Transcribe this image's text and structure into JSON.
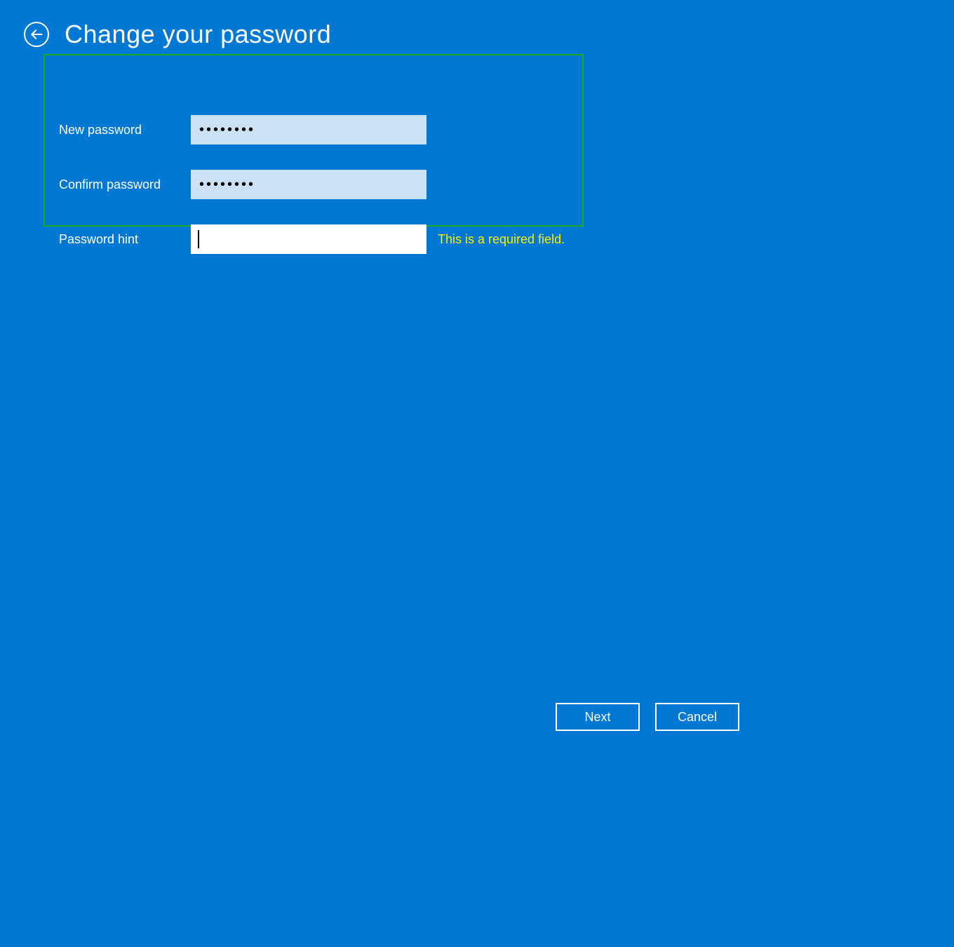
{
  "header": {
    "title": "Change your password"
  },
  "form": {
    "new_password_label": "New password",
    "new_password_value": "••••••••",
    "confirm_password_label": "Confirm password",
    "confirm_password_value": "••••••••",
    "hint_label": "Password hint",
    "hint_value": "",
    "hint_error": "This is a required field."
  },
  "footer": {
    "next_label": "Next",
    "cancel_label": "Cancel"
  }
}
